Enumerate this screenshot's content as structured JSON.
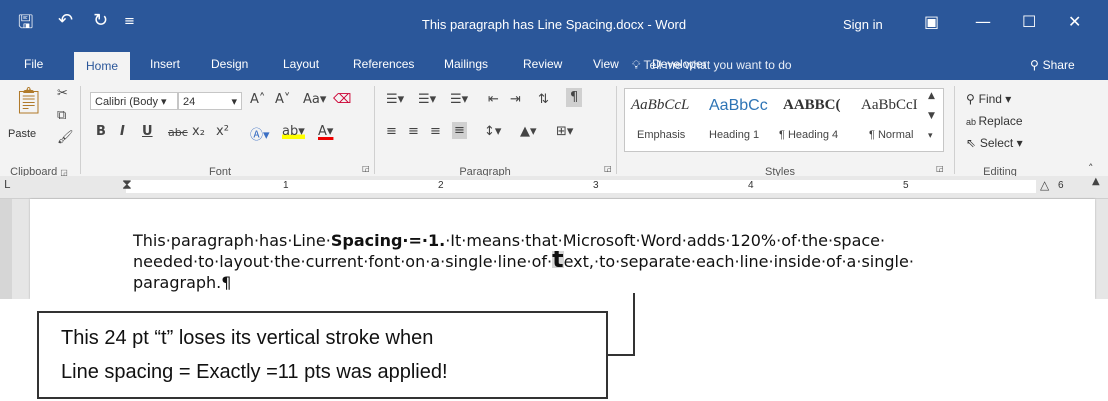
{
  "window": {
    "title": "This paragraph has Line Spacing.docx - Word",
    "signin": "Sign in",
    "share": "Share",
    "tell_me": "Tell me what you want to do"
  },
  "quick_access": {
    "save_icon": "save-icon",
    "undo_icon": "undo-icon",
    "redo_icon": "redo-icon",
    "customize_icon": "customize-icon"
  },
  "window_buttons": [
    "ribbon-display-icon",
    "minimize-icon",
    "maximize-icon",
    "close-icon"
  ],
  "tabs": [
    "File",
    "Home",
    "Insert",
    "Design",
    "Layout",
    "References",
    "Mailings",
    "Review",
    "View",
    "Developer"
  ],
  "active_tab": "Home",
  "ribbon": {
    "clipboard": {
      "label": "Clipboard",
      "paste": "Paste"
    },
    "font": {
      "label": "Font",
      "font_name": "Calibri (Body",
      "font_size": "24",
      "bold": "B",
      "italic": "I",
      "underline": "U",
      "strikethrough": "abc",
      "subscript": "x₂",
      "superscript": "x²",
      "change_case": "Aa"
    },
    "paragraph": {
      "label": "Paragraph"
    },
    "styles": {
      "label": "Styles",
      "items": [
        {
          "sample": "AaBbCcL",
          "name": "Emphasis"
        },
        {
          "sample": "AaBbCc",
          "name": "Heading 1"
        },
        {
          "sample": "AABBC(",
          "name": "¶ Heading 4"
        },
        {
          "sample": "AaBbCcI",
          "name": "¶ Normal"
        }
      ]
    },
    "editing": {
      "label": "Editing",
      "find": "Find",
      "replace": "Replace",
      "select": "Select"
    }
  },
  "ruler": {
    "numbers": [
      "1",
      "2",
      "3",
      "4",
      "5",
      "6"
    ]
  },
  "document": {
    "line1_pre": "This·paragraph·has·Line·",
    "line1_bold": "Spacing·=·1.",
    "line1_post": "·It·means·that·Microsoft·Word·adds·120%·of·the·space·",
    "line2_pre": "needed·to·layout·the·current·font·on·a·single·line·of·",
    "line2_big_t": "t",
    "line2_post": "ext,·to·separate·each·line·inside·of·a·single·",
    "line3": "paragraph.¶"
  },
  "callout": {
    "line1": "This 24 pt “t” loses its vertical stroke when",
    "line2": "Line spacing = Exactly =11 pts was applied!"
  },
  "colors": {
    "word_blue": "#2b579a",
    "ribbon_bg": "#f3f3f3"
  }
}
